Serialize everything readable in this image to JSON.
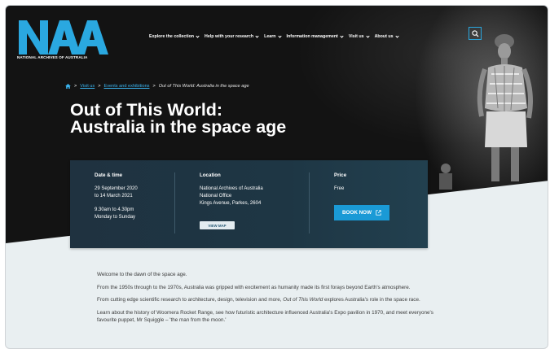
{
  "logo": {
    "letters": "NAA",
    "text": "NATIONAL ARCHIVES OF AUSTRALIA"
  },
  "nav": {
    "items": [
      {
        "label": "Explore the collection"
      },
      {
        "label": "Help with your research"
      },
      {
        "label": "Learn"
      },
      {
        "label": "Information management"
      },
      {
        "label": "Visit us"
      },
      {
        "label": "About us"
      }
    ],
    "search_icon": "search-icon"
  },
  "breadcrumb": {
    "home_icon": "home-icon",
    "items": [
      "Visit us",
      "Events and exhibitions"
    ],
    "current": "Out of This World: Australia in the space age",
    "separator": ">"
  },
  "page_title": {
    "line1": "Out of This World:",
    "line2": "Australia in the space age"
  },
  "event": {
    "date_time": {
      "heading": "Date & time",
      "lines": [
        "29 September 2020",
        "to 14 March 2021",
        "9.30am to 4.30pm",
        "Monday to Sunday"
      ]
    },
    "location": {
      "heading": "Location",
      "lines": [
        "National Archives of Australia",
        "National Office",
        "Kings Avenue, Parkes, 2604"
      ],
      "map_button": "VIEW MAP"
    },
    "price": {
      "heading": "Price",
      "value": "Free",
      "book_button": "BOOK NOW",
      "book_icon": "external-link-icon"
    }
  },
  "content": {
    "p1": "Welcome to the dawn of the space age.",
    "p2": "From the 1950s through to the 1970s, Australia was gripped with excitement as humanity made its first forays beyond Earth's atmosphere.",
    "p3_a": "From cutting edge scientific research to architecture, design, television and more, ",
    "p3_em": "Out of This World",
    "p3_b": " explores Australia's role in the space race.",
    "p4": "Learn about the history of Woomera Rocket Range, see how futuristic architecture influenced Australia's Expo pavilion in 1970, and meet everyone's favourite puppet, Mr Squiggle – 'the man from the moon.'"
  },
  "colors": {
    "accent": "#1a9ad6",
    "logo": "#2aa8e0",
    "hero_bg": "#131313",
    "card_bg": "#1f3240",
    "page_bg": "#e9eff1"
  }
}
